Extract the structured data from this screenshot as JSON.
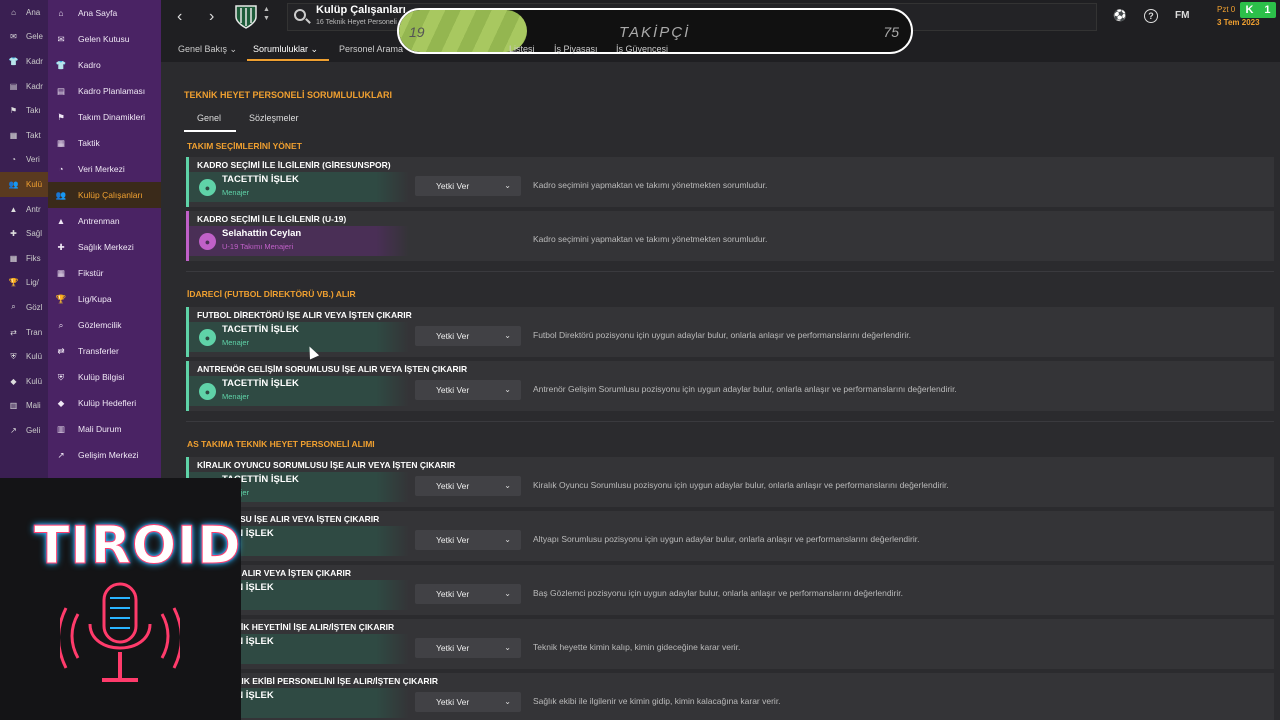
{
  "strip": {
    "items": [
      {
        "label": "Ana",
        "icon": "home-icon",
        "glyph": "⌂"
      },
      {
        "label": "Gele",
        "icon": "inbox-icon",
        "glyph": "✉"
      },
      {
        "label": "Kadr",
        "icon": "shirt-icon",
        "glyph": "👕"
      },
      {
        "label": "Kadr",
        "icon": "squad-plan-icon",
        "glyph": "▤"
      },
      {
        "label": "Takı",
        "icon": "dynamics-icon",
        "glyph": "⚑"
      },
      {
        "label": "Takt",
        "icon": "tactics-icon",
        "glyph": "▦"
      },
      {
        "label": "Veri",
        "icon": "data-icon",
        "glyph": "◔"
      },
      {
        "label": "Kulü",
        "icon": "staff-icon",
        "glyph": "👥",
        "active": true
      },
      {
        "label": "Antr",
        "icon": "training-icon",
        "glyph": "▲"
      },
      {
        "label": "Sağl",
        "icon": "medical-icon",
        "glyph": "✚"
      },
      {
        "label": "Fiks",
        "icon": "calendar-icon",
        "glyph": "▦"
      },
      {
        "label": "Lig/",
        "icon": "trophy-icon",
        "glyph": "🏆"
      },
      {
        "label": "Gözl",
        "icon": "scouting-icon",
        "glyph": "⌕"
      },
      {
        "label": "Tran",
        "icon": "transfer-icon",
        "glyph": "⇄"
      },
      {
        "label": "Kulü",
        "icon": "club-info-icon",
        "glyph": "⛨"
      },
      {
        "label": "Kulü",
        "icon": "club-vision-icon",
        "glyph": "◆"
      },
      {
        "label": "Mali",
        "icon": "finance-icon",
        "glyph": "▥"
      },
      {
        "label": "Geli",
        "icon": "development-icon",
        "glyph": "↗"
      }
    ]
  },
  "menu": {
    "items": [
      {
        "label": "Ana Sayfa",
        "icon": "home-icon",
        "glyph": "⌂"
      },
      {
        "label": "Gelen Kutusu",
        "icon": "inbox-icon",
        "glyph": "✉"
      },
      {
        "label": "Kadro",
        "icon": "shirt-icon",
        "glyph": "👕"
      },
      {
        "label": "Kadro Planlaması",
        "icon": "squad-plan-icon",
        "glyph": "▤"
      },
      {
        "label": "Takım Dinamikleri",
        "icon": "dynamics-icon",
        "glyph": "⚑"
      },
      {
        "label": "Taktik",
        "icon": "tactics-icon",
        "glyph": "▦"
      },
      {
        "label": "Veri Merkezi",
        "icon": "data-icon",
        "glyph": "◔"
      },
      {
        "label": "Kulüp Çalışanları",
        "icon": "staff-icon",
        "glyph": "👥",
        "active": true
      },
      {
        "label": "Antrenman",
        "icon": "training-icon",
        "glyph": "▲"
      },
      {
        "label": "Sağlık Merkezi",
        "icon": "medical-icon",
        "glyph": "✚"
      },
      {
        "label": "Fikstür",
        "icon": "calendar-icon",
        "glyph": "▦"
      },
      {
        "label": "Lig/Kupa",
        "icon": "trophy-icon",
        "glyph": "🏆"
      },
      {
        "label": "Gözlemcilik",
        "icon": "scouting-icon",
        "glyph": "⌕"
      },
      {
        "label": "Transferler",
        "icon": "transfer-icon",
        "glyph": "⇄"
      },
      {
        "label": "Kulüp Bilgisi",
        "icon": "club-info-icon",
        "glyph": "⛨"
      },
      {
        "label": "Kulüp Hedefleri",
        "icon": "club-vision-icon",
        "glyph": "◆"
      },
      {
        "label": "Mali Durum",
        "icon": "finance-icon",
        "glyph": "▥"
      },
      {
        "label": "Gelişim Merkezi",
        "icon": "development-icon",
        "glyph": "↗"
      }
    ]
  },
  "topbar": {
    "back": "‹",
    "forward": "›",
    "title": "Kulüp Çalışanları",
    "subtitle": "16 Teknik Heyet Personeli",
    "follow_left": "19",
    "follow_label": "TAKİPÇİ",
    "follow_right": "75",
    "follow_progress": 0.25,
    "day": "Pzt 0",
    "date": "3 Tem 2023",
    "fm": "FM",
    "help": "?",
    "badge_k": "K",
    "badge_n": "1",
    "accent": "#f0a030"
  },
  "tabs": [
    {
      "label": "Genel Bakış ⌄"
    },
    {
      "label": "Sorumluluklar ⌄",
      "active": true
    },
    {
      "label": "Personel Arama"
    },
    {
      "label": "Listesi"
    },
    {
      "label": "İş Piyasası"
    },
    {
      "label": "İş Güvencesi"
    }
  ],
  "main": {
    "heading": "TEKNİK HEYET PERSONELİ SORUMLULUKLARI",
    "subtabs": [
      "Genel",
      "Sözleşmeler"
    ],
    "groups": [
      {
        "title": "TAKIM SEÇİMLERİNİ YÖNET"
      },
      {
        "title": "İDARECİ (FUTBOL DİREKTÖRÜ VB.) ALIR"
      },
      {
        "title": "AS TAKIMA TEKNİK HEYET PERSONELİ ALIMI"
      }
    ],
    "rows": [
      {
        "title": "KADRO SEÇİMİ İLE İLGİLENİR (GİRESUNSPOR)",
        "name": "TACETTİN İŞLEK",
        "role": "Menajer",
        "action": "Yetki Ver",
        "desc": "Kadro seçimini yapmaktan ve takımı yönetmekten sorumludur."
      },
      {
        "title": "KADRO SEÇİMİ İLE İLGİLENİR (U-19)",
        "name": "Selahattin Ceylan",
        "role": "U-19 Takımı Menajeri",
        "action": "",
        "desc": "Kadro seçimini yapmaktan ve takımı yönetmekten sorumludur."
      },
      {
        "title": "FUTBOL DİREKTÖRÜ İŞE ALIR VEYA İŞTEN ÇIKARIR",
        "name": "TACETTİN İŞLEK",
        "role": "Menajer",
        "action": "Yetki Ver",
        "desc": "Futbol Direktörü pozisyonu için uygun adaylar bulur, onlarla anlaşır ve performanslarını değerlendirir."
      },
      {
        "title": "ANTRENÖR GELİŞİM SORUMLUSU İŞE ALIR VEYA İŞTEN ÇIKARIR",
        "name": "TACETTİN İŞLEK",
        "role": "Menajer",
        "action": "Yetki Ver",
        "desc": "Antrenör Gelişim Sorumlusu pozisyonu için uygun adaylar bulur, onlarla anlaşır ve performanslarını değerlendirir."
      },
      {
        "title": "KİRALIK OYUNCU SORUMLUSU İŞE ALIR VEYA İŞTEN ÇIKARIR",
        "name": "TACETTİN İŞLEK",
        "role": "Menajer",
        "action": "Yetki Ver",
        "desc": "Kiralık Oyuncu Sorumlusu pozisyonu için uygun adaylar bulur, onlarla anlaşır ve performanslarını değerlendirir."
      },
      {
        "title": "SORUMLUSU İŞE ALIR VEYA İŞTEN ÇIKARIR",
        "name": "TTİN İŞLEK",
        "role": "ajer",
        "action": "Yetki Ver",
        "desc": "Altyapı Sorumlusu pozisyonu için uygun adaylar bulur, onlarla anlaşır ve performanslarını değerlendirir."
      },
      {
        "title": "LEMCİ İŞE ALIR VEYA İŞTEN ÇIKARIR",
        "name": "TTİN İŞLEK",
        "role": "ajer",
        "action": "Yetki Ver",
        "desc": "Baş Gözlemci pozisyonu için uygun adaylar bulur, onlarla anlaşır ve performanslarını değerlendirir."
      },
      {
        "title": "POR TEKNİK HEYETİNİ İŞE ALIR/İŞTEN ÇIKARIR",
        "name": "TTİN İŞLEK",
        "role": "ajer",
        "action": "Yetki Ver",
        "desc": "Teknik heyette kimin kalıp, kimin gideceğine karar verir."
      },
      {
        "title": "POR SAĞLIK EKİBİ PERSONELİNİ İŞE ALIR/İŞTEN ÇIKARIR",
        "name": "TTİN İŞLEK",
        "role": "ajer",
        "action": "Yetki Ver",
        "desc": "Sağlık ekibi ile ilgilenir ve kimin gidip, kimin kalacağına karar verir."
      }
    ]
  },
  "overlay": {
    "title": "TIROID",
    "icon": "microphone-icon"
  }
}
